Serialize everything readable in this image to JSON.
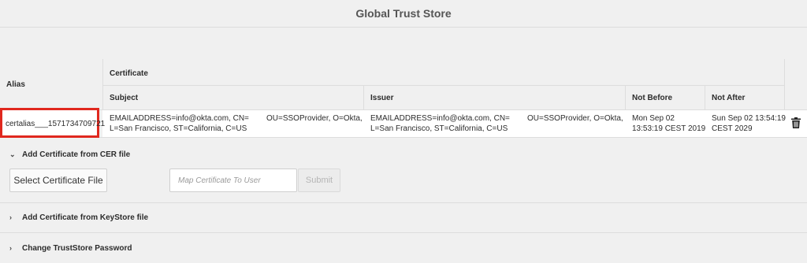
{
  "window": {
    "title": "Global Trust Store"
  },
  "table": {
    "headers": {
      "alias": "Alias",
      "certificate": "Certificate",
      "subject": "Subject",
      "issuer": "Issuer",
      "not_before": "Not Before",
      "not_after": "Not After"
    },
    "rows": [
      {
        "alias": "certalias___1571734709721",
        "subject_line1": "EMAILADDRESS=info@okta.com, CN=",
        "subject_line1b": "OU=SSOProvider, O=Okta,",
        "subject_line2": "L=San Francisco, ST=California, C=US",
        "issuer_line1": "EMAILADDRESS=info@okta.com, CN=",
        "issuer_line1b": "OU=SSOProvider, O=Okta,",
        "issuer_line2": "L=San Francisco, ST=California, C=US",
        "not_before_line1": "Mon Sep 02",
        "not_before_line2": "13:53:19 CEST 2019",
        "not_after_line1": "Sun Sep 02 13:54:19",
        "not_after_line2": "CEST 2029"
      }
    ],
    "delete_icon": "trash-icon",
    "highlight_color": "#e0281e"
  },
  "sections": {
    "add_cer": {
      "label": "Add Certificate from CER file",
      "expanded": true
    },
    "add_keystore": {
      "label": "Add Certificate from KeyStore file",
      "expanded": false
    },
    "change_password": {
      "label": "Change TrustStore Password",
      "expanded": false
    }
  },
  "cer_form": {
    "select_button": "Select Certificate File",
    "map_placeholder": "Map Certificate To User",
    "submit_button": "Submit"
  }
}
